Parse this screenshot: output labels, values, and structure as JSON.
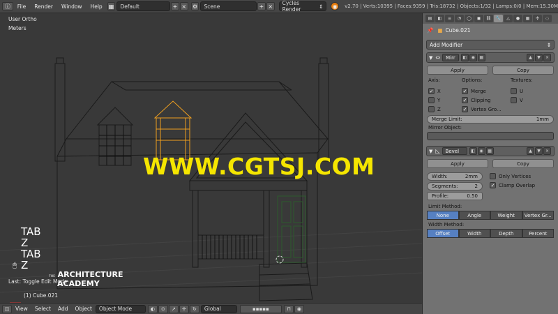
{
  "topbar": {
    "menus": [
      "File",
      "Render",
      "Window",
      "Help"
    ],
    "layout": "Default",
    "scene": "Scene",
    "engine": "Cycles Render",
    "stats": "v2.70 | Verts:10395 | Faces:9359 | Tris:18732 | Objects:1/32 | Lamps:0/0 | Mem:15.30M"
  },
  "viewport": {
    "view_name": "User Ortho",
    "units": "Meters",
    "watermark": "WWW.CGTSJ.COM",
    "keys": [
      "TAB",
      "Z",
      "TAB",
      "Z"
    ],
    "last_op": "Last: Toggle Edit Mode",
    "logo_line1": "ARCHITECTURE",
    "logo_line2": "ACADEMY",
    "logo_prefix": "THE",
    "object_label": "(1) Cube.021"
  },
  "bottombar": {
    "menus": [
      "View",
      "Select",
      "Add",
      "Object"
    ],
    "mode": "Object Mode",
    "orientation": "Global"
  },
  "panel": {
    "object_name": "Cube.021",
    "add_modifier": "Add Modifier",
    "mirror": {
      "name": "Mirr",
      "apply": "Apply",
      "copy": "Copy",
      "axis_label": "Axis:",
      "options_label": "Options:",
      "textures_label": "Textures:",
      "axis": [
        "X",
        "Y",
        "Z"
      ],
      "options": [
        "Merge",
        "Clipping",
        "Vertex Gro..."
      ],
      "textures": [
        "U",
        "V"
      ],
      "merge_limit_label": "Merge Limit:",
      "merge_limit_value": "1mm",
      "mirror_object_label": "Mirror Object:"
    },
    "bevel": {
      "name": "Bevel",
      "apply": "Apply",
      "copy": "Copy",
      "width_label": "Width:",
      "width_value": "2mm",
      "segments_label": "Segments:",
      "segments_value": "2",
      "profile_label": "Profile:",
      "profile_value": "0.50",
      "only_vertices": "Only Vertices",
      "clamp_overlap": "Clamp Overlap",
      "limit_method_label": "Limit Method:",
      "limit_methods": [
        "None",
        "Angle",
        "Weight",
        "Vertex Gr..."
      ],
      "width_method_label": "Width Method:",
      "width_methods": [
        "Offset",
        "Width",
        "Depth",
        "Percent"
      ]
    }
  },
  "colors": {
    "accent": "#5680c2",
    "watermark": "#f5e600",
    "selected_wire": "#f0a020"
  }
}
